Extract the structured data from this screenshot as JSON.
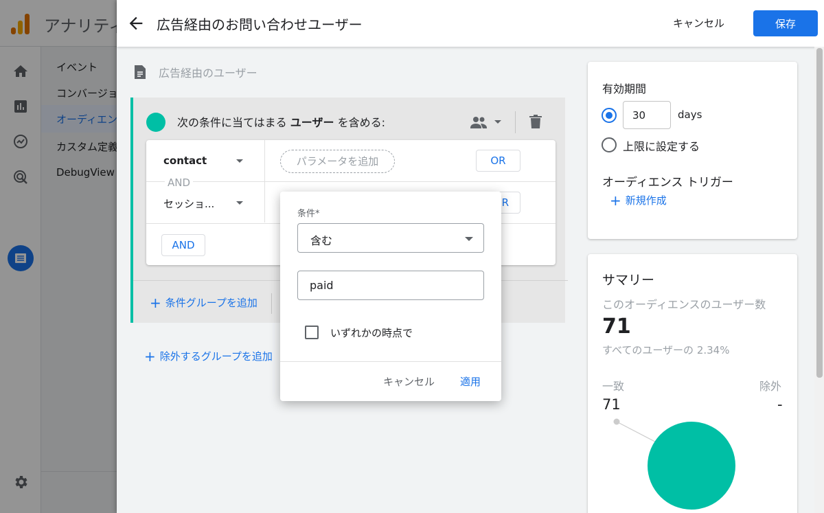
{
  "background": {
    "app_title": "アナリティ",
    "side_items": [
      "イベント",
      "コンバージョ",
      "オーディエン",
      "カスタム定義",
      "DebugView"
    ]
  },
  "header": {
    "title": "広告経由のお問い合わせユーザー",
    "cancel_label": "キャンセル",
    "save_label": "保存"
  },
  "description": "広告経由のユーザー",
  "group": {
    "head_prefix": "次の条件に当てはまる",
    "head_bold": "ユーザー",
    "head_suffix": "を含める:",
    "conditions": [
      {
        "dimension": "contact"
      },
      {
        "dimension": "セッショ..."
      }
    ],
    "and_inline": "AND",
    "param_placeholder": "パラメータを追加",
    "or_label": "OR",
    "or_partial": "R",
    "and_button": "AND",
    "add_group": "条件グループを追加",
    "add_exclude": "除外するグループを追加"
  },
  "duration": {
    "title": "有効期間",
    "days_value": "30",
    "days_unit": "days",
    "no_limit": "上限に設定する",
    "trigger_title": "オーディエンス トリガー",
    "new_create": "新規作成"
  },
  "summary": {
    "title": "サマリー",
    "subtitle": "このオーディエンスのユーザー数",
    "count": "71",
    "percent_text": "すべてのユーザーの 2.34%",
    "match_label": "一致",
    "exclude_label": "除外",
    "match_value": "71",
    "exclude_value": "-"
  },
  "popup": {
    "label": "条件*",
    "selected": "含む",
    "value": "paid",
    "checkbox_label": "いずれかの時点で",
    "cancel": "キャンセル",
    "apply": "適用"
  },
  "colors": {
    "accent": "#1a73e8",
    "teal": "#00bfa5"
  }
}
